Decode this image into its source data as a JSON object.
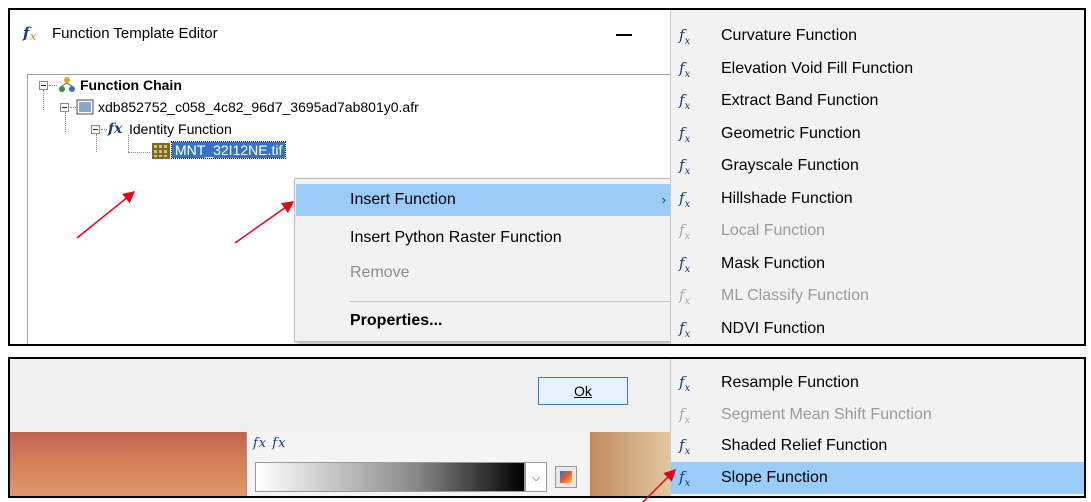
{
  "dialog": {
    "title": "Function Template Editor",
    "ok_label": "Ok"
  },
  "tree": {
    "root_label": "Function Chain",
    "raster_label": "xdb852752_c058_4c82_96d7_3695ad7ab801y0.afr",
    "function_label": "Identity Function",
    "selected_node_label": "MNT_32I12NE.tif"
  },
  "context_menu": {
    "items": [
      {
        "label": "Insert Function",
        "state": "highlighted",
        "has_submenu": true
      },
      {
        "label": "Insert Python Raster Function",
        "state": "enabled"
      },
      {
        "label": "Remove",
        "state": "disabled"
      },
      {
        "label": "Properties...",
        "state": "enabled",
        "bold": true
      }
    ],
    "submenu_arrow": "›"
  },
  "function_list_top": [
    {
      "label": "Curvature Function",
      "enabled": true
    },
    {
      "label": "Elevation Void Fill Function",
      "enabled": true
    },
    {
      "label": "Extract Band Function",
      "enabled": true
    },
    {
      "label": "Geometric Function",
      "enabled": true
    },
    {
      "label": "Grayscale Function",
      "enabled": true
    },
    {
      "label": "Hillshade Function",
      "enabled": true
    },
    {
      "label": "Local Function",
      "enabled": false
    },
    {
      "label": "Mask Function",
      "enabled": true
    },
    {
      "label": "ML Classify Function",
      "enabled": false
    },
    {
      "label": "NDVI Function",
      "enabled": true
    }
  ],
  "function_list_bottom": [
    {
      "label": "Resample Function",
      "enabled": true
    },
    {
      "label": "Segment Mean Shift Function",
      "enabled": false
    },
    {
      "label": "Shaded Relief Function",
      "enabled": true
    },
    {
      "label": "Slope Function",
      "enabled": true,
      "highlighted": true
    }
  ],
  "icons": {
    "function": "fx-icon",
    "chain": "function-chain-icon",
    "raster": "raster-dataset-icon",
    "tif": "raster-grid-icon",
    "minimize": "minimize-icon",
    "arrow": "red-arrow-annotation"
  },
  "colors": {
    "highlight": "#99ccf7",
    "menu_bg": "#f2f2f2",
    "disabled_text": "#8c8c8c",
    "annotation": "#e8001c",
    "ok_button_border": "#3a78c8"
  }
}
